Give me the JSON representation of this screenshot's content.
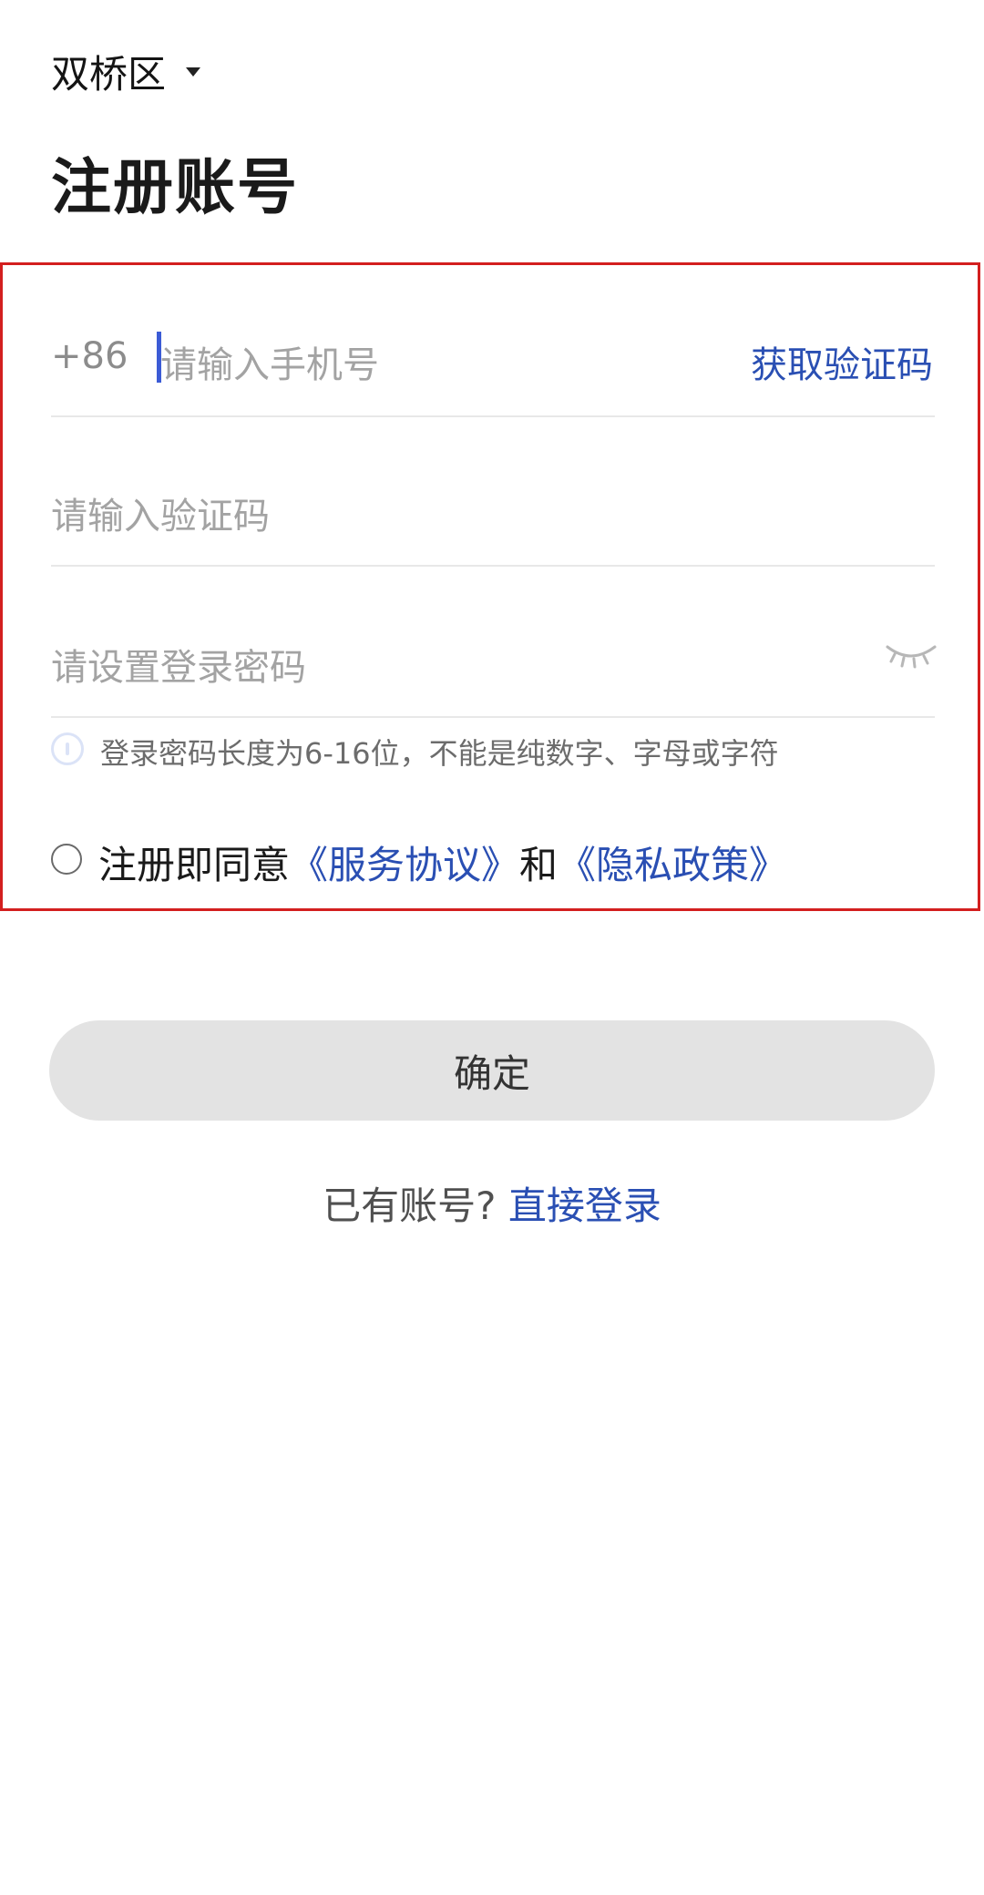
{
  "header": {
    "region": "双桥区",
    "title": "注册账号"
  },
  "form": {
    "country_code": "+86",
    "phone_placeholder": "请输入手机号",
    "get_code_label": "获取验证码",
    "code_placeholder": "请输入验证码",
    "password_placeholder": "请设置登录密码",
    "password_hint": "登录密码长度为6-16位，不能是纯数字、字母或字符"
  },
  "agreement": {
    "prefix": "注册即同意",
    "service_link": "《服务协议》",
    "conjunction": "和",
    "privacy_link": "《隐私政策》"
  },
  "actions": {
    "confirm_label": "确定",
    "have_account_text": "已有账号?",
    "login_link": "直接登录"
  },
  "colors": {
    "link": "#2a4fb3",
    "highlight_border": "#d31f1f",
    "button_bg": "#e3e3e3"
  }
}
